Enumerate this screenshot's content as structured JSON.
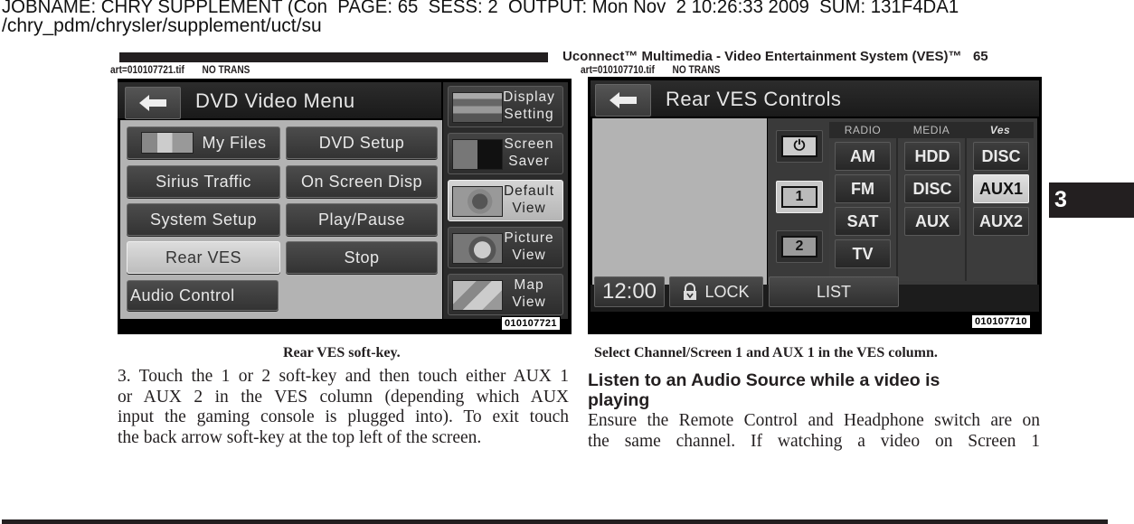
{
  "print_header": {
    "jobline": "JOBNAME: CHRY SUPPLEMENT (Con  PAGE: 65  SESS: 2  OUTPUT: Mon Nov  2 10:26:33 2009  SUM: 131F4DA1",
    "path": "/chry_pdm/chrysler/supplement/uct/su"
  },
  "page_header": {
    "title": "Uconnect™ Multimedia - Video Entertainment System (VES)™   65",
    "page_number": "65"
  },
  "figures": [
    {
      "art_label": "art=010107721.tif",
      "trans_label": "NO TRANS",
      "art_number": "010107721",
      "caption": "Rear VES soft-key.",
      "screen": {
        "title": "DVD Video Menu",
        "back_icon": "back-arrow-icon",
        "buttons": [
          {
            "label": "My Files",
            "icon": "media-files-icon",
            "selected": false
          },
          {
            "label": "DVD Setup",
            "selected": false
          },
          {
            "label": "Sirius Traffic",
            "selected": false
          },
          {
            "label": "On  Screen  Disp",
            "selected": false
          },
          {
            "label": "System Setup",
            "selected": false
          },
          {
            "label": "Play/Pause",
            "selected": false
          },
          {
            "label": "Rear  VES",
            "selected": true
          },
          {
            "label": "Stop",
            "selected": false
          },
          {
            "label": "Audio Control",
            "selected": false
          }
        ],
        "side_buttons": [
          {
            "line1": "Display",
            "line2": "Setting",
            "icon": "display-setting-icon",
            "selected": false
          },
          {
            "line1": "Screen",
            "line2": "Saver",
            "icon": "screen-saver-icon",
            "selected": false
          },
          {
            "line1": "Default",
            "line2": "View",
            "icon": "default-view-icon",
            "selected": true
          },
          {
            "line1": "Picture",
            "line2": "View",
            "icon": "picture-view-icon",
            "selected": false
          },
          {
            "line1": "Map",
            "line2": "View",
            "icon": "map-view-icon",
            "selected": false
          }
        ]
      }
    },
    {
      "art_label": "art=010107710.tif",
      "trans_label": "NO TRANS",
      "art_number": "010107710",
      "caption": "Select Channel/Screen 1 and AUX 1 in the VES column.",
      "screen": {
        "title": "Rear VES Controls",
        "back_icon": "back-arrow-icon",
        "power_icon": "power-icon",
        "channels": [
          {
            "label": "1",
            "selected": true
          },
          {
            "label": "2",
            "selected": false
          }
        ],
        "columns": [
          {
            "header": "RADIO",
            "items": [
              {
                "label": "AM",
                "selected": false
              },
              {
                "label": "FM",
                "selected": false
              },
              {
                "label": "SAT",
                "selected": false
              },
              {
                "label": "TV",
                "selected": false
              }
            ]
          },
          {
            "header": "MEDIA",
            "items": [
              {
                "label": "HDD",
                "selected": false
              },
              {
                "label": "DISC",
                "selected": false
              },
              {
                "label": "AUX",
                "selected": false
              }
            ]
          },
          {
            "header": "Ves",
            "items": [
              {
                "label": "DISC",
                "selected": false
              },
              {
                "label": "AUX1",
                "selected": true
              },
              {
                "label": "AUX2",
                "selected": false
              }
            ]
          }
        ],
        "bottom": {
          "clock": "12:00",
          "lock_label": "LOCK",
          "list_label": "LIST"
        }
      }
    }
  ],
  "left_text": {
    "lines": [
      "3.  Touch the 1 or 2 soft-key and then touch either AUX 1",
      "or AUX 2 in the VES column (depending which AUX",
      "input the gaming console is plugged into). To exit touch",
      "the back arrow soft-key at the top left of the screen."
    ]
  },
  "right_text": {
    "heading_line1": "Listen to an Audio Source while a video is",
    "heading_line2": "playing",
    "lines": [
      "Ensure the Remote Control and Headphone switch are on",
      "the same channel. If watching a video on Screen 1"
    ]
  },
  "section_tab": "3"
}
